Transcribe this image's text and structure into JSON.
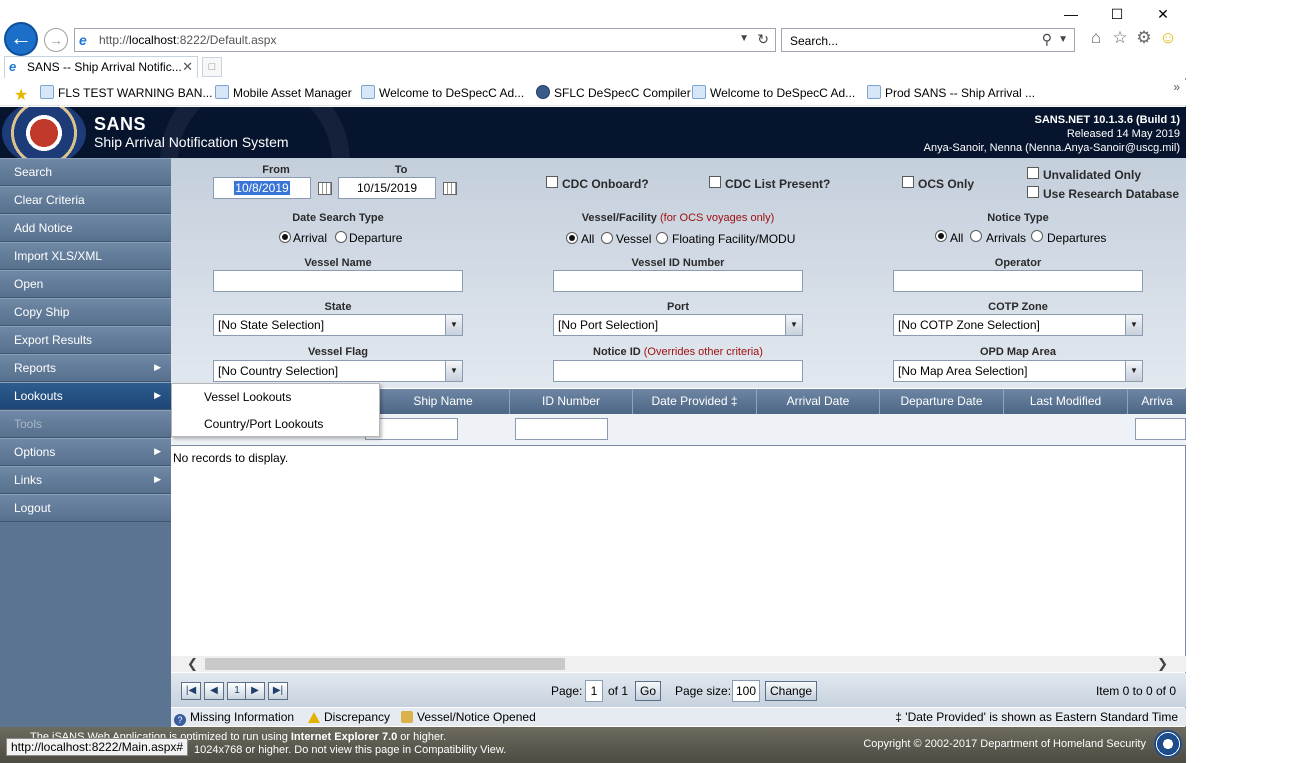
{
  "browser": {
    "url_prefix": "http://",
    "url_host": "localhost",
    "url_rest": ":8222/Default.aspx",
    "search_placeholder": "Search...",
    "tab_title": "SANS -- Ship Arrival Notific...",
    "favorites": [
      "FLS TEST WARNING BAN...",
      "Mobile Asset Manager",
      "Welcome to DeSpecC Ad...",
      "SFLC DeSpecC Compiler",
      "Welcome to DeSpecC Ad...",
      "Prod SANS -- Ship Arrival ..."
    ],
    "status_url": "http://localhost:8222/Main.aspx#"
  },
  "header": {
    "title": "SANS",
    "subtitle": "Ship Arrival Notification System",
    "version": "SANS.NET 10.1.3.6 (Build 1)",
    "released": "Released 14 May 2019",
    "user": "Anya-Sanoir, Nenna (Nenna.Anya-Sanoir@uscg.mil)"
  },
  "menu": {
    "items": [
      {
        "label": "Search"
      },
      {
        "label": "Clear Criteria"
      },
      {
        "label": "Add Notice"
      },
      {
        "label": "Import XLS/XML"
      },
      {
        "label": "Open"
      },
      {
        "label": "Copy Ship"
      },
      {
        "label": "Export Results"
      },
      {
        "label": "Reports"
      },
      {
        "label": "Lookouts"
      },
      {
        "label": "Tools"
      },
      {
        "label": "Options"
      },
      {
        "label": "Links"
      },
      {
        "label": "Logout"
      }
    ],
    "submenu": [
      "Vessel Lookouts",
      "Country/Port Lookouts"
    ]
  },
  "criteria": {
    "from_label": "From",
    "to_label": "To",
    "from_value": "10/8/2019",
    "to_value": "10/15/2019",
    "cdc_onboard": "CDC Onboard?",
    "cdc_list": "CDC List Present?",
    "ocs_only": "OCS Only",
    "unvalidated": "Unvalidated Only",
    "research_db": "Use Research Database",
    "date_search_type": "Date Search Type",
    "arrival": "Arrival",
    "departure": "Departure",
    "vessel_facility": "Vessel/Facility",
    "vessel_facility_note": "(for OCS voyages only)",
    "all": "All",
    "vessel": "Vessel",
    "floating": "Floating Facility/MODU",
    "notice_type": "Notice Type",
    "arrivals": "Arrivals",
    "departures": "Departures",
    "vessel_name": "Vessel Name",
    "vessel_id": "Vessel ID Number",
    "operator": "Operator",
    "state": "State",
    "state_value": "[No State Selection]",
    "port": "Port",
    "port_value": "[No Port Selection]",
    "cotp": "COTP Zone",
    "cotp_value": "[No COTP Zone Selection]",
    "flag": "Vessel Flag",
    "flag_value": "[No Country Selection]",
    "notice_id": "Notice ID",
    "notice_id_note": "(Overrides other criteria)",
    "opd": "OPD Map Area",
    "opd_value": "[No Map Area Selection]"
  },
  "grid": {
    "columns": [
      "Ship Name",
      "ID Number",
      "Date Provided ‡",
      "Arrival Date",
      "Departure Date",
      "Last Modified",
      "Arriva"
    ],
    "empty": "No records to display."
  },
  "pager": {
    "page_label": "Page:",
    "page_value": "1",
    "of_text": "of 1",
    "go": "Go",
    "size_label": "Page size:",
    "size_value": "100",
    "change": "Change",
    "items_text": "Item 0 to 0 of 0",
    "page_button": "1"
  },
  "legend": {
    "missing": "Missing Information",
    "discrepancy": "Discrepancy",
    "opened": "Vessel/Notice Opened",
    "note": "‡ 'Date Provided' is shown as Eastern Standard Time"
  },
  "footer": {
    "line1_a": "The iSANS Web Application is optimized to run using ",
    "line1_b": "Internet Explorer 7.0",
    "line1_c": " or higher.",
    "line2": "1024x768 or higher. Do not view this page in Compatibility View.",
    "copyright": "Copyright © 2002-2017 Department of Homeland Security"
  }
}
